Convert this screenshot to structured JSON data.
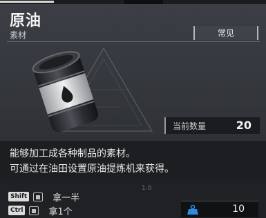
{
  "title": "原油",
  "category": "素材",
  "rarity": "常见",
  "count_label": "当前数量",
  "count_value": "20",
  "description": [
    "能够加工成各种制品的素材。",
    "可通过在油田设置原油提炼机来获得。"
  ],
  "actions": [
    {
      "key": "Shift",
      "label": "拿一半"
    },
    {
      "key": "Ctrl",
      "label": "拿1个"
    }
  ],
  "scale_tick": "1.0",
  "quantity": "10",
  "icons": {
    "item": "oil-barrel-icon",
    "weight": "weight-icon"
  }
}
